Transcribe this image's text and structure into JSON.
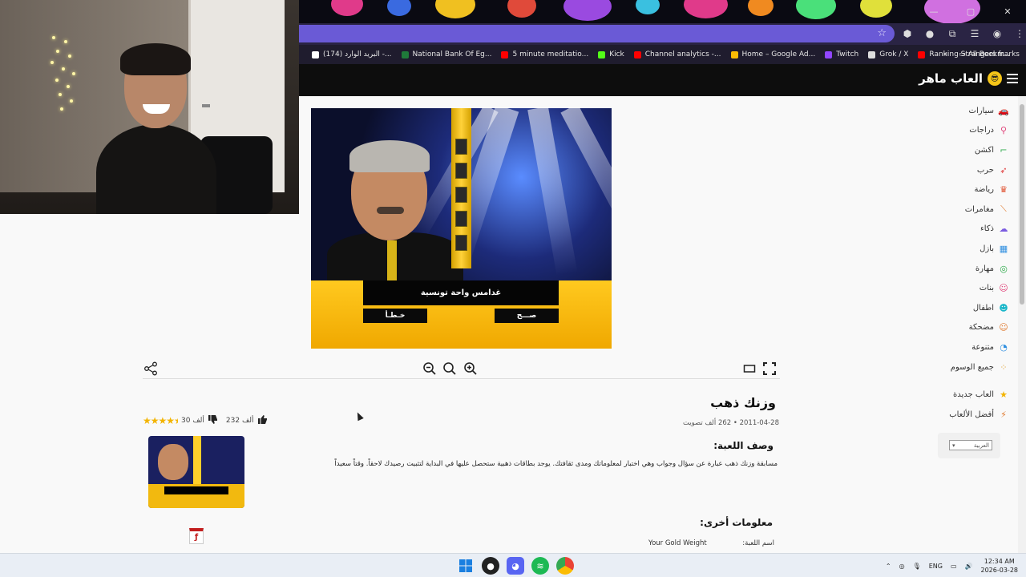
{
  "browser": {
    "bookmarks": [
      {
        "label": "البريد الوارد ‏(174)‏ -...",
        "icon": "gmail-icon",
        "color": "#ffffff"
      },
      {
        "label": "National Bank Of Eg...",
        "icon": "bank-icon",
        "color": "#1f7a3a"
      },
      {
        "label": "5 minute meditatio...",
        "icon": "youtube-icon",
        "color": "#ff0000"
      },
      {
        "label": "Kick",
        "icon": "kick-icon",
        "color": "#53fc18"
      },
      {
        "label": "Channel analytics -...",
        "icon": "youtube-icon",
        "color": "#ff0000"
      },
      {
        "label": "Home – Google Ad...",
        "icon": "google-ads-icon",
        "color": "#fbbc04"
      },
      {
        "label": "Twitch",
        "icon": "twitch-icon",
        "color": "#9146ff"
      },
      {
        "label": "Grok / X",
        "icon": "x-icon",
        "color": "#dddddd"
      },
      {
        "label": "Ranking Strangers fr...",
        "icon": "youtube-icon",
        "color": "#ff0000"
      }
    ],
    "all_bookmarks": "All Bookmarks"
  },
  "site": {
    "logo": "العاب ماهر",
    "categories": [
      {
        "label": "سيارات",
        "icon": "car-icon",
        "color": "#19b6c9"
      },
      {
        "label": "دراجات",
        "icon": "bike-icon",
        "color": "#e0457b"
      },
      {
        "label": "اكشن",
        "icon": "gun-icon",
        "color": "#2eaa4a"
      },
      {
        "label": "حرب",
        "icon": "rocket-icon",
        "color": "#e03a3a"
      },
      {
        "label": "رياضة",
        "icon": "trophy-icon",
        "color": "#e0502f"
      },
      {
        "label": "مغامرات",
        "icon": "knife-icon",
        "color": "#e07a2f"
      },
      {
        "label": "ذكاء",
        "icon": "brain-icon",
        "color": "#7b5ce0"
      },
      {
        "label": "بازل",
        "icon": "puzzle-icon",
        "color": "#2f8fe0"
      },
      {
        "label": "مهارة",
        "icon": "target-icon",
        "color": "#2eaa4a"
      },
      {
        "label": "بنات",
        "icon": "girl-icon",
        "color": "#e0457b"
      },
      {
        "label": "اطفال",
        "icon": "kid-icon",
        "color": "#19b6c9"
      },
      {
        "label": "مضحكة",
        "icon": "laugh-icon",
        "color": "#e07a2f"
      },
      {
        "label": "متنوعة",
        "icon": "mixed-icon",
        "color": "#2f8fe0"
      },
      {
        "label": "جميع الوسوم",
        "icon": "tags-icon",
        "color": "#e0a02f"
      }
    ],
    "extra_links": [
      {
        "label": "العاب جديدة",
        "icon": "star-icon",
        "color": "#f3b400"
      },
      {
        "label": "أفضل الألعاب",
        "icon": "fire-icon",
        "color": "#e07a2f"
      }
    ],
    "language": "العربية"
  },
  "game": {
    "question": "غدامس واحة تونسية",
    "answer_wrong": "خـطـأ",
    "answer_right": "صـــح",
    "title": "وزنك ذهب",
    "meta": "2011-04-28 • 262 ألف تصويت",
    "likes": "232 ألف",
    "dislikes": "30 ألف",
    "rating": 4.5,
    "description_heading": "وصف اللعبة:",
    "description": "مسابقة وزنك ذهب عبارة عن سؤال وجواب وهي اختبار لمعلوماتك ومدى ثقافتك. يوجد بطاقات ذهبية ستحصل عليها في البداية لتثبيت رصيدك لاحقاً. وقتاً سعيداً",
    "other_info_heading": "معلومات أخرى:",
    "name_label": "اسم اللعبة:",
    "name_value": "Your Gold Weight"
  },
  "taskbar": {
    "language": "ENG",
    "time": "12:34 AM",
    "date": "2026-03-28"
  }
}
